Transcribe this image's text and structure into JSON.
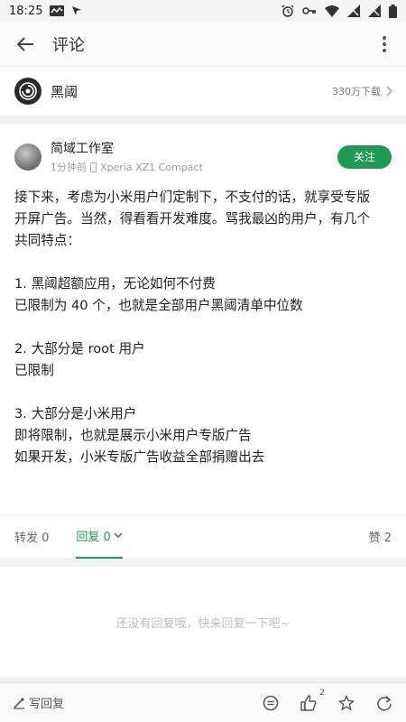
{
  "status_bar": {
    "time": "18:25"
  },
  "app_bar": {
    "title": "评论"
  },
  "app_row": {
    "name": "黑阈",
    "downloads": "330万下载"
  },
  "post": {
    "author_name": "简域工作室",
    "time_ago": "1分钟前",
    "device": "Xperia XZ1 Compact",
    "follow_label": "关注",
    "lines": [
      "接下来，考虑为小米用户们定制下，不支付的话，就享受专版",
      "开屏广告。当然，得看看开发难度。骂我最凶的用户，有几个",
      "共同特点：",
      "",
      "1. 黑阈超额应用，无论如何不付费",
      "已限制为 40 个，也就是全部用户黑阈清单中位数",
      "",
      "2. 大部分是 root 用户",
      "已限制",
      "",
      "3. 大部分是小米用户",
      "即将限制，也就是展示小米用户专版广告",
      "如果开发，小米专版广告收益全部捐赠出去"
    ]
  },
  "actions": {
    "repost": "转发 0",
    "reply": "回复 0",
    "likes": "赞 2"
  },
  "empty_text": "还没有回复哦，快来回复一下吧~",
  "bottom_bar": {
    "write_reply": "写回复",
    "like_count": "2"
  },
  "colors": {
    "accent": "#1e9a55"
  }
}
